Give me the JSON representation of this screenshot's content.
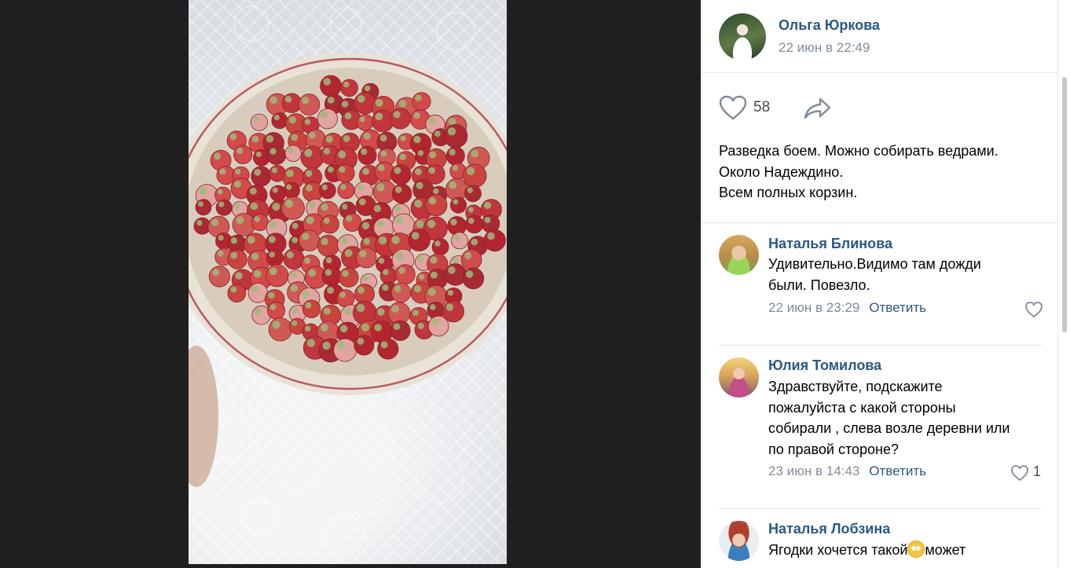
{
  "post": {
    "author_name": "Ольга Юркова",
    "date": "22 июн в 22:49",
    "likes": "58",
    "text_lines": [
      "Разведка боем. Можно собирать ведрами.",
      "Около Надеждино.",
      "Всем полных корзин."
    ]
  },
  "comments": [
    {
      "author": "Наталья Блинова",
      "text_lines": [
        "Удивительно.Видимо там дожди",
        "были. Повезло."
      ],
      "date": "22 июн в 23:29",
      "reply_label": "Ответить",
      "likes": ""
    },
    {
      "author": "Юлия Томилова",
      "text_lines": [
        "Здравствуйте, подскажите",
        "пожалуйста с какой стороны",
        "собирали , слева возле деревни или",
        "по правой стороне?"
      ],
      "date": "23 июн в 14:43",
      "reply_label": "Ответить",
      "likes": "1"
    },
    {
      "author": "Наталья Лобзина",
      "text_before_emoji": "Ягодки хочется такой",
      "text_after_emoji": "может"
    }
  ],
  "icons": {
    "like": "heart-icon",
    "share": "share-arrow-icon",
    "comment_like": "heart-outline-icon",
    "emoji": "flushed-face-emoji"
  },
  "colors": {
    "link": "#2a5885",
    "meta": "#818c99",
    "divider": "#e7e8ec",
    "backdrop": "#1f1f1f"
  }
}
